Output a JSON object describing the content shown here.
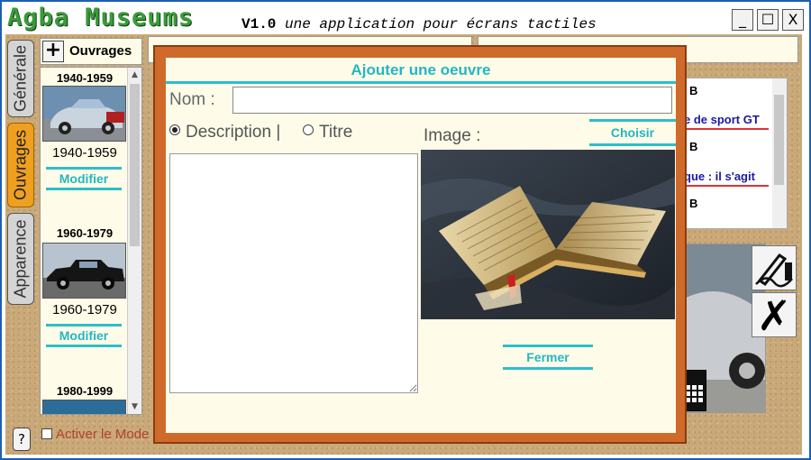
{
  "app": {
    "title": "Agba Museums",
    "version": "V1.0",
    "subtitle": "une application pour écrans tactiles",
    "window_controls": {
      "minimize": "_",
      "maximize": "☐",
      "close": "X"
    }
  },
  "tabs": [
    {
      "label": "Générale",
      "active": false
    },
    {
      "label": "Ouvrages",
      "active": true
    },
    {
      "label": "Apparence",
      "active": false
    }
  ],
  "help_label": "?",
  "ouvrages": {
    "add_label": "+",
    "title": "Ouvrages",
    "modify_label": "Modifier",
    "items": [
      {
        "header": "1940-1959",
        "label": "1940-1959"
      },
      {
        "header": "1960-1979",
        "label": "1960-1979"
      },
      {
        "header": "1980-1999",
        "label": ""
      }
    ]
  },
  "activate_label": "Activer le Mode",
  "background_list": {
    "entries": [
      {
        "letter": "B",
        "text": "e de sport GT"
      },
      {
        "letter": "B",
        "text": "que : il s'agit"
      },
      {
        "letter": "B",
        "text": ""
      }
    ]
  },
  "modal": {
    "title": "Ajouter une oeuvre",
    "nom_label": "Nom :",
    "nom_value": "",
    "radio_description": "Description |",
    "radio_titre": "Titre",
    "selected_radio": "description",
    "description_text": "",
    "image_label": "Image :",
    "choose_label": "Choisir",
    "close_label": "Fermer"
  },
  "colors": {
    "accent": "#22b6c4",
    "modal_frame": "#d06a2a",
    "active_tab": "#f0a020",
    "title_green": "#3a9a3a"
  }
}
